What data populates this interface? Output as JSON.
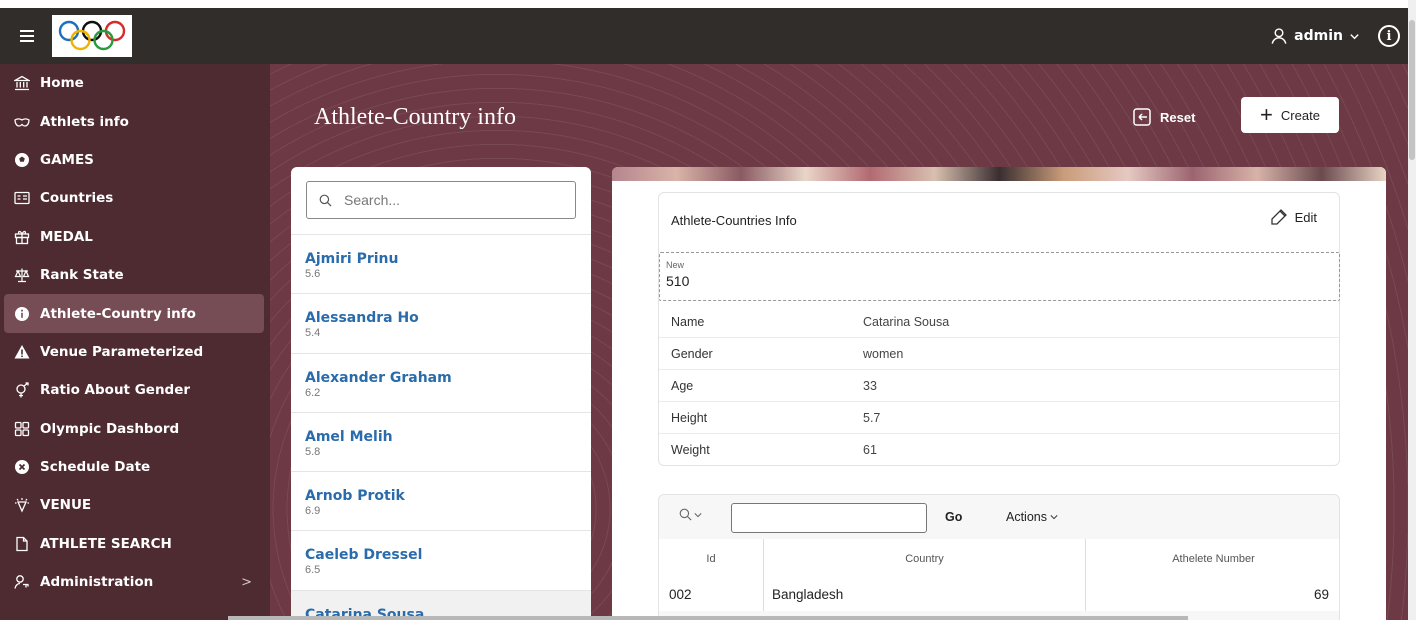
{
  "header": {
    "user_name": "admin",
    "info_glyph": "i"
  },
  "sidebar": {
    "items": [
      {
        "label": "Home",
        "icon": "bank-icon"
      },
      {
        "label": "Athlets info",
        "icon": "masks-icon"
      },
      {
        "label": "GAMES",
        "icon": "soccer-ball-icon"
      },
      {
        "label": "Countries",
        "icon": "id-card-icon"
      },
      {
        "label": "MEDAL",
        "icon": "gift-icon"
      },
      {
        "label": "Rank State",
        "icon": "scale-icon"
      },
      {
        "label": "Athlete-Country info",
        "icon": "info-circle-icon",
        "active": true
      },
      {
        "label": "Venue Parameterized",
        "icon": "warning-icon"
      },
      {
        "label": "Ratio About Gender",
        "icon": "gender-icon"
      },
      {
        "label": "Olympic Dashbord",
        "icon": "grid-icon"
      },
      {
        "label": "Schedule Date",
        "icon": "close-circle-icon"
      },
      {
        "label": "VENUE",
        "icon": "bulb-icon"
      },
      {
        "label": "ATHLETE SEARCH",
        "icon": "file-icon"
      },
      {
        "label": "Administration",
        "icon": "user-key-icon",
        "chevron": ">"
      }
    ]
  },
  "page": {
    "title": "Athlete-Country info",
    "reset_label": "Reset",
    "create_label": "Create"
  },
  "list": {
    "search_placeholder": "Search...",
    "items": [
      {
        "name": "Ajmiri Prinu",
        "value": "5.6"
      },
      {
        "name": "Alessandra Ho",
        "value": "5.4"
      },
      {
        "name": "Alexander Graham",
        "value": "6.2"
      },
      {
        "name": "Amel Melih",
        "value": "5.8"
      },
      {
        "name": "Arnob Protik",
        "value": "6.9"
      },
      {
        "name": "Caeleb Dressel",
        "value": "6.5"
      },
      {
        "name": "Catarina Sousa",
        "value": ""
      }
    ]
  },
  "detail": {
    "card_title": "Athlete-Countries Info",
    "edit_label": "Edit",
    "new_label": "New",
    "new_value": "510",
    "properties": [
      {
        "key": "Name",
        "value": "Catarina Sousa"
      },
      {
        "key": "Gender",
        "value": "women"
      },
      {
        "key": "Age",
        "value": "33"
      },
      {
        "key": "Height",
        "value": "5.7"
      },
      {
        "key": "Weight",
        "value": "61"
      }
    ]
  },
  "report": {
    "go_label": "Go",
    "actions_label": "Actions",
    "columns": [
      "Id",
      "Country",
      "Athelete Number"
    ],
    "rows": [
      {
        "id": "002",
        "country": "Bangladesh",
        "number": "69"
      }
    ]
  }
}
